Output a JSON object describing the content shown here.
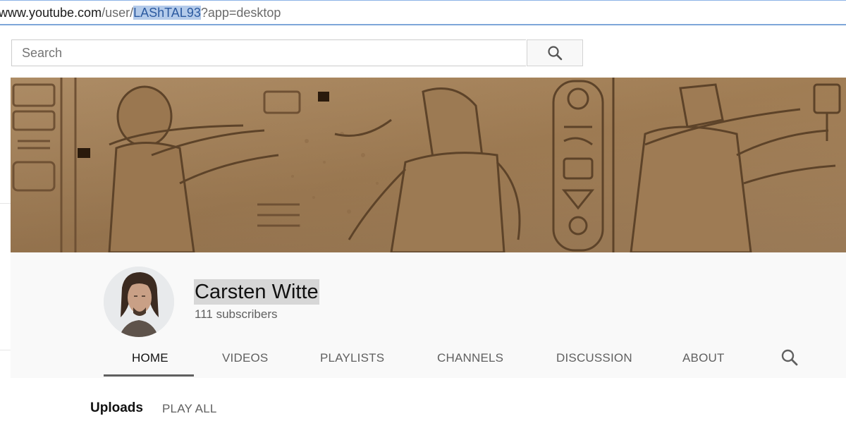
{
  "browser": {
    "url_host": "www.youtube.com",
    "url_path_prefix": "/user/",
    "url_user_selected": "LAShTAL93",
    "url_query": "?app=desktop"
  },
  "search": {
    "placeholder": "Search",
    "button_icon": "search-icon"
  },
  "channel": {
    "name": "Carsten Witte",
    "subscribers": "111 subscribers",
    "banner": "egyptian-relief-banner"
  },
  "tabs": [
    {
      "label": "HOME",
      "active": true
    },
    {
      "label": "VIDEOS",
      "active": false
    },
    {
      "label": "PLAYLISTS",
      "active": false
    },
    {
      "label": "CHANNELS",
      "active": false
    },
    {
      "label": "DISCUSSION",
      "active": false
    },
    {
      "label": "ABOUT",
      "active": false
    }
  ],
  "tab_search_icon": "search-icon",
  "section": {
    "title": "Uploads",
    "play_all": "PLAY ALL"
  },
  "colors": {
    "selection": "#b4cbea",
    "name_highlight": "#d7d7d7",
    "tab_active_underline": "#606060"
  }
}
